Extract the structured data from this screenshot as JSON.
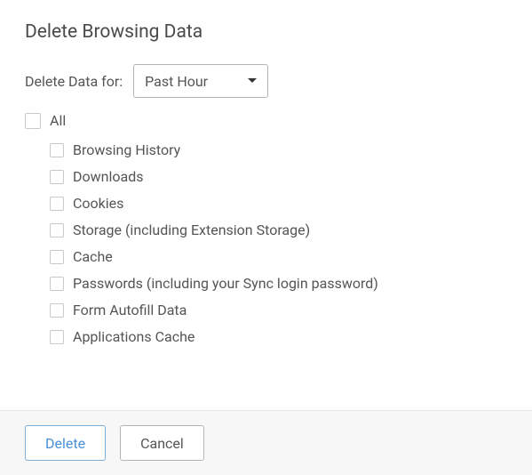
{
  "title": "Delete Browsing Data",
  "time": {
    "label": "Delete Data for:",
    "selected": "Past Hour"
  },
  "all": {
    "label": "All",
    "checked": false
  },
  "items": [
    {
      "label": "Browsing History",
      "checked": false
    },
    {
      "label": "Downloads",
      "checked": false
    },
    {
      "label": "Cookies",
      "checked": false
    },
    {
      "label": "Storage (including Extension Storage)",
      "checked": false
    },
    {
      "label": "Cache",
      "checked": false
    },
    {
      "label": "Passwords (including your Sync login password)",
      "checked": false
    },
    {
      "label": "Form Autofill Data",
      "checked": false
    },
    {
      "label": "Applications Cache",
      "checked": false
    }
  ],
  "buttons": {
    "delete": "Delete",
    "cancel": "Cancel"
  }
}
